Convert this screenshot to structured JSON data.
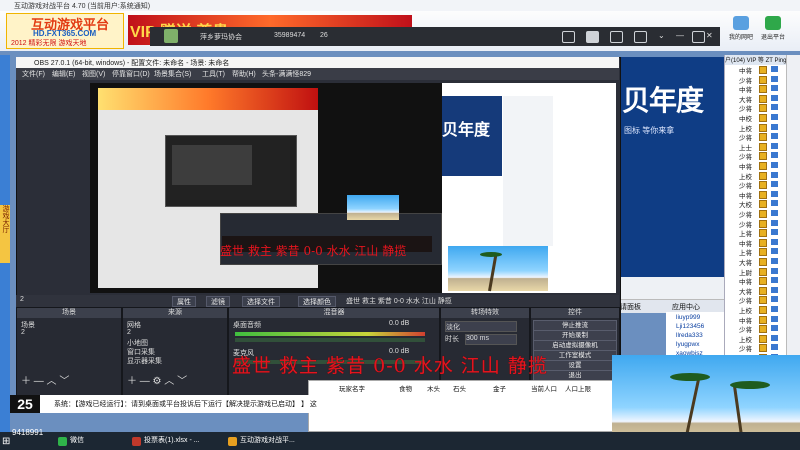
{
  "outer_window": {
    "title": "互动游戏对战平台 4.70 (当前用户:系统通知)",
    "logo_main": "互动游戏平台",
    "logo_url": "HD.FXT365.COM",
    "logo_tag": "2012 精彩无限 游戏天地",
    "vip_banner": "VIP 赠送 尊贵",
    "top_icons": [
      "我的网吧",
      "退出平台"
    ],
    "left_tag": "游戏大厅",
    "ad_big": "贝年度",
    "ad_sub": "图标  等你来拿",
    "chat_app_label": "应用中心",
    "chat_label2": "请面板"
  },
  "client_bar": {
    "name": "萍乡萝玛协会",
    "id": "35989474",
    "count": "26"
  },
  "right_panel": {
    "header": "户(104)  VIP 等 ZT  Ping",
    "rows": [
      {
        "rank": "中将"
      },
      {
        "rank": "少将"
      },
      {
        "rank": "中将"
      },
      {
        "rank": "大将"
      },
      {
        "rank": "少将"
      },
      {
        "rank": "中校"
      },
      {
        "rank": "上校"
      },
      {
        "rank": "少将"
      },
      {
        "rank": "上士"
      },
      {
        "rank": "少将"
      },
      {
        "rank": "中将"
      },
      {
        "rank": "上校"
      },
      {
        "rank": "少将"
      },
      {
        "rank": "中将"
      },
      {
        "rank": "大校"
      },
      {
        "rank": "少将"
      },
      {
        "rank": "少将"
      },
      {
        "rank": "上将"
      },
      {
        "rank": "中将"
      },
      {
        "rank": "上将"
      },
      {
        "rank": "大将"
      },
      {
        "rank": "上尉"
      },
      {
        "rank": "中将"
      },
      {
        "rank": "大将"
      },
      {
        "rank": "少将"
      },
      {
        "rank": "上校"
      },
      {
        "rank": "中将"
      },
      {
        "rank": "少将"
      },
      {
        "rank": "上校"
      },
      {
        "rank": "少将"
      },
      {
        "rank": "中校"
      },
      {
        "rank": "上校"
      },
      {
        "rank": "少将"
      },
      {
        "rank": "中将"
      }
    ]
  },
  "member_list": [
    "liuyp999",
    "Lji123456",
    "llreda333",
    "lyugpwx",
    "xaowbjsz"
  ],
  "obs": {
    "title": "OBS 27.0.1 (64-bit, windows) - 配置文件: 未命名 - 场景: 未命名",
    "menu": [
      "文件(F)",
      "编辑(E)",
      "视图(V)",
      "停靠窗口(D)",
      "场景集合(S)",
      "工具(T)",
      "帮助(H)",
      "头条-满满怪829"
    ],
    "toolbar_buttons": [
      "属性",
      "滤镜",
      "选择文件",
      "选择颜色"
    ],
    "toolbar_text": "盛世  救主  紫昔  0-0  水水  江山  静揽",
    "scene_label": "2",
    "docks": {
      "scenes": {
        "title": "场景",
        "items": [
          "场景",
          "2"
        ]
      },
      "sources": {
        "title": "来源",
        "items": [
          "网格",
          "2",
          "小地图",
          "窗口采集",
          "显示器采集"
        ]
      },
      "mixer": {
        "title": "混音器",
        "track1": "桌面音频",
        "track1_val": "0.0 dB",
        "track2": "麦克风",
        "track2_val": "0.0 dB"
      },
      "transitions": {
        "title": "转场特效",
        "mode": "淡化",
        "duration_label": "时长",
        "duration": "300 ms"
      },
      "controls": {
        "title": "控件",
        "buttons": [
          "停止推流",
          "开始录制",
          "启动虚拟摄像机",
          "工作室模式",
          "设置",
          "退出"
        ]
      }
    }
  },
  "overlay_text": "盛世 救主 紫昔 0-0 水水 江山 静揽",
  "overlay_text2": "盛世  救主  紫昔  0-0  水水  江山  静揽",
  "sheet": {
    "headers": [
      "玩家名字",
      "食物",
      "木头",
      "石头",
      "金子",
      "当前人口",
      "人口上限"
    ]
  },
  "status": {
    "badge": "25",
    "text": "系统：【游戏已经运行】：请到桌面或平台投诉后下运行【解决提示游戏已启动】 】 这",
    "id": "9418991"
  },
  "taskbar": [
    {
      "label": "微信",
      "color": "#2fb34a"
    },
    {
      "label": "投票表(1).xlsx - ...",
      "color": "#c0392b"
    },
    {
      "label": "互动游戏对战平...",
      "color": "#e8a020"
    }
  ]
}
